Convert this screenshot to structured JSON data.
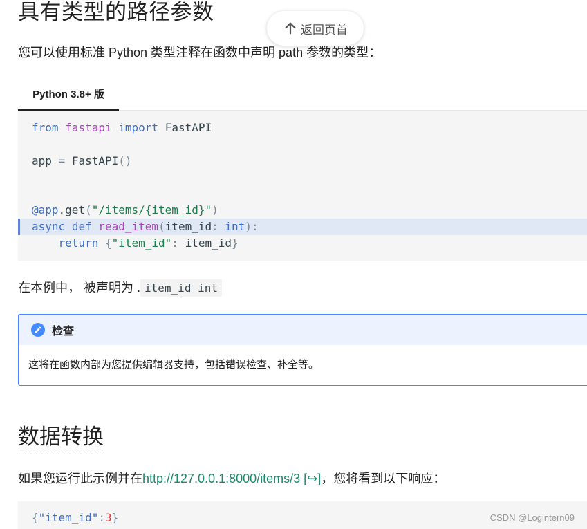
{
  "section_title": "具有类型的路径参数",
  "back_to_top": "返回页首",
  "intro_text": "您可以使用标准 Python 类型注释在函数中声明 path 参数的类型：",
  "tab_label": "Python 3.8+ 版",
  "code1": {
    "line1": {
      "kw1": "from",
      "mod": "fastapi",
      "kw2": "import",
      "name": "FastAPI"
    },
    "line2": {
      "lhs": "app",
      "eq": " = ",
      "call": "FastAPI",
      "paren": "()"
    },
    "line3": {
      "dec": "@app",
      "dot": ".get",
      "open": "(",
      "str": "\"/items/{item_id}\"",
      "close": ")"
    },
    "line4": {
      "kw1": "async",
      "kw2": "def",
      "fn": "read_item",
      "open": "(",
      "param": "item_id",
      "colon": ": ",
      "type": "int",
      "close": "):"
    },
    "line5": {
      "indent": "    ",
      "kw": "return",
      "open": " {",
      "key": "\"item_id\"",
      "colon": ": ",
      "val": "item_id",
      "close": "}"
    }
  },
  "example_text": {
    "prefix": "在本例中， 被声明为 .",
    "code": "item_id int"
  },
  "admonition": {
    "title": "检查",
    "body": "这将在函数内部为您提供编辑器支持，包括错误检查、补全等。"
  },
  "section2_title": "数据转换",
  "run_text": {
    "prefix": "如果您运行此示例并在",
    "link": "http://127.0.0.1:8000/items/3 [↪]",
    "suffix": "，您将看到以下响应："
  },
  "code2": {
    "open": "{",
    "key": "\"item_id\"",
    "colon": ":",
    "val": "3",
    "close": "}"
  },
  "watermark": "CSDN @Logintern09"
}
